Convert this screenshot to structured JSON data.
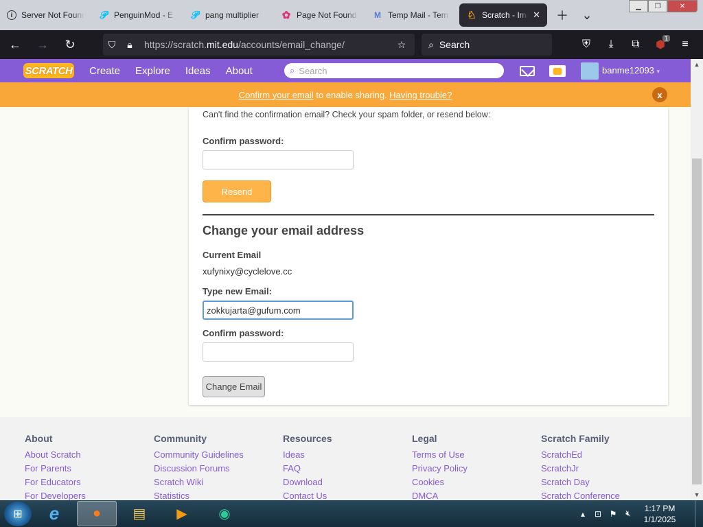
{
  "browser": {
    "tabs": [
      {
        "icon": "info-icon",
        "title": "Server Not Found"
      },
      {
        "icon": "penguinmod-icon",
        "title": "PenguinMod - E"
      },
      {
        "icon": "penguinmod-icon",
        "title": "pang multiplier"
      },
      {
        "icon": "page-not-found-icon",
        "title": "Page Not Found"
      },
      {
        "icon": "mail-icon",
        "title": "Temp Mail - Tem"
      },
      {
        "icon": "scratch-icon",
        "title": "Scratch - Imag"
      }
    ],
    "url_prefix": "https://scratch.",
    "url_domain": "mit.edu",
    "url_path": "/accounts/email_change/",
    "search_label": "Search",
    "extension_badge": "1"
  },
  "scratch": {
    "logo": "SCRATCH",
    "nav": {
      "create": "Create",
      "explore": "Explore",
      "ideas": "Ideas",
      "about": "About"
    },
    "search_placeholder": "Search",
    "username": "banme12093",
    "banner": {
      "confirm_link": "Confirm your email",
      "middle": " to enable sharing. ",
      "trouble_link": "Having trouble?",
      "close": "x"
    }
  },
  "form": {
    "note": "Can't find the confirmation email? Check your spam folder, or resend below:",
    "confirm_password_label": "Confirm password:",
    "resend_label": "Resend",
    "section_title": "Change your email address",
    "current_email_label": "Current Email",
    "current_email_value": "xufynixy@cyclelove.cc",
    "new_email_label": "Type new Email:",
    "new_email_value": "zokkujarta@gufum.com",
    "confirm_password_label_2": "Confirm password:",
    "change_email_label": "Change Email"
  },
  "footer": {
    "columns": [
      {
        "heading": "About",
        "links": [
          "About Scratch",
          "For Parents",
          "For Educators",
          "For Developers"
        ]
      },
      {
        "heading": "Community",
        "links": [
          "Community Guidelines",
          "Discussion Forums",
          "Scratch Wiki",
          "Statistics"
        ]
      },
      {
        "heading": "Resources",
        "links": [
          "Ideas",
          "FAQ",
          "Download",
          "Contact Us"
        ]
      },
      {
        "heading": "Legal",
        "links": [
          "Terms of Use",
          "Privacy Policy",
          "Cookies",
          "DMCA"
        ]
      },
      {
        "heading": "Scratch Family",
        "links": [
          "ScratchEd",
          "ScratchJr",
          "Scratch Day",
          "Scratch Conference"
        ]
      }
    ]
  },
  "taskbar": {
    "time": "1:17 PM",
    "date": "1/1/2025"
  },
  "colors": {
    "scratch_purple": "#855cd6",
    "banner_orange": "#f9a739",
    "resend_orange": "#ffb44a"
  }
}
